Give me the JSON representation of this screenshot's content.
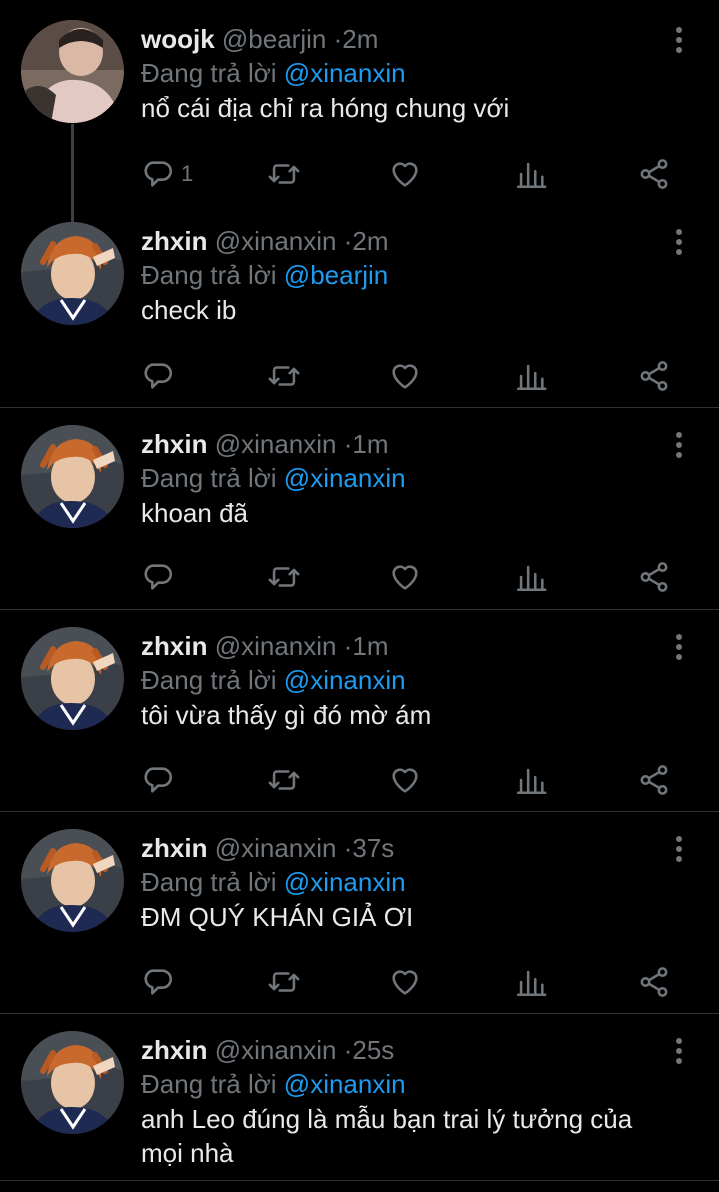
{
  "reply_prefix": "Đang trả lời",
  "tweets": [
    {
      "name": "woojk",
      "handle": "@bearjin",
      "time": "2m",
      "reply_to": "@xinanxin",
      "text": "nổ cái địa chỉ ra hóng chung với",
      "reply_count": "1"
    },
    {
      "name": "zhxin",
      "handle": "@xinanxin",
      "time": "2m",
      "reply_to": "@bearjin",
      "text": "check ib",
      "reply_count": ""
    },
    {
      "name": "zhxin",
      "handle": "@xinanxin",
      "time": "1m",
      "reply_to": "@xinanxin",
      "text": "khoan đã",
      "reply_count": ""
    },
    {
      "name": "zhxin",
      "handle": "@xinanxin",
      "time": "1m",
      "reply_to": "@xinanxin",
      "text": "tôi vừa thấy gì đó mờ ám",
      "reply_count": ""
    },
    {
      "name": "zhxin",
      "handle": "@xinanxin",
      "time": "37s",
      "reply_to": "@xinanxin",
      "text": "ĐM QUÝ KHÁN GIẢ ƠI",
      "reply_count": ""
    },
    {
      "name": "zhxin",
      "handle": "@xinanxin",
      "time": "25s",
      "reply_to": "@xinanxin",
      "text": "anh Leo đúng là mẫu bạn trai lý tưởng của mọi nhà",
      "reply_count": ""
    }
  ],
  "icons": {
    "reply": "reply-icon",
    "retweet": "retweet-icon",
    "like": "heart-icon",
    "views": "analytics-icon",
    "share": "share-icon",
    "more": "more-vertical-icon"
  },
  "colors": {
    "background": "#000000",
    "primary_text": "#e7e9ea",
    "secondary_text": "#71767b",
    "mention": "#1d9bf0",
    "divider": "#2f3336"
  }
}
